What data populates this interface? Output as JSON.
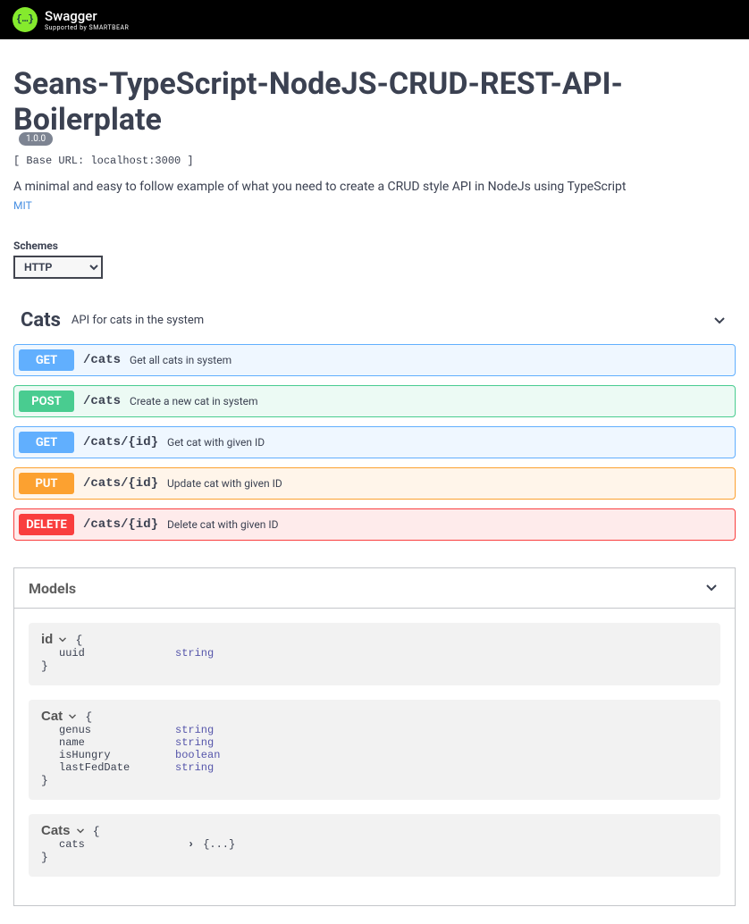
{
  "logo": {
    "main": "Swagger",
    "sub": "Supported by SMARTBEAR",
    "glyph": "{…}"
  },
  "info": {
    "title": "Seans-TypeScript-NodeJS-CRUD-REST-API-Boilerplate",
    "version": "1.0.0",
    "base_url": "[ Base URL: localhost:3000 ]",
    "description": "A minimal and easy to follow example of what you need to create a CRUD style API in NodeJs using TypeScript",
    "license": "MIT"
  },
  "schemes": {
    "label": "Schemes",
    "selected": "HTTP"
  },
  "tag": {
    "name": "Cats",
    "description": "API for cats in the system"
  },
  "ops": [
    {
      "method": "GET",
      "cls": "get",
      "path": "/cats",
      "summary": "Get all cats in system"
    },
    {
      "method": "POST",
      "cls": "post",
      "path": "/cats",
      "summary": "Create a new cat in system"
    },
    {
      "method": "GET",
      "cls": "get",
      "path": "/cats/{id}",
      "summary": "Get cat with given ID"
    },
    {
      "method": "PUT",
      "cls": "put",
      "path": "/cats/{id}",
      "summary": "Update cat with given ID"
    },
    {
      "method": "DELETE",
      "cls": "delete",
      "path": "/cats/{id}",
      "summary": "Delete cat with given ID"
    }
  ],
  "models_title": "Models",
  "models": [
    {
      "name": "id",
      "props": [
        {
          "name": "uuid",
          "type": "string"
        }
      ]
    },
    {
      "name": "Cat",
      "props": [
        {
          "name": "genus",
          "type": "string"
        },
        {
          "name": "name",
          "type": "string"
        },
        {
          "name": "isHungry",
          "type": "boolean"
        },
        {
          "name": "lastFedDate",
          "type": "string"
        }
      ]
    },
    {
      "name": "Cats",
      "props": [
        {
          "name": "cats",
          "type_expand": "{...}"
        }
      ]
    }
  ]
}
